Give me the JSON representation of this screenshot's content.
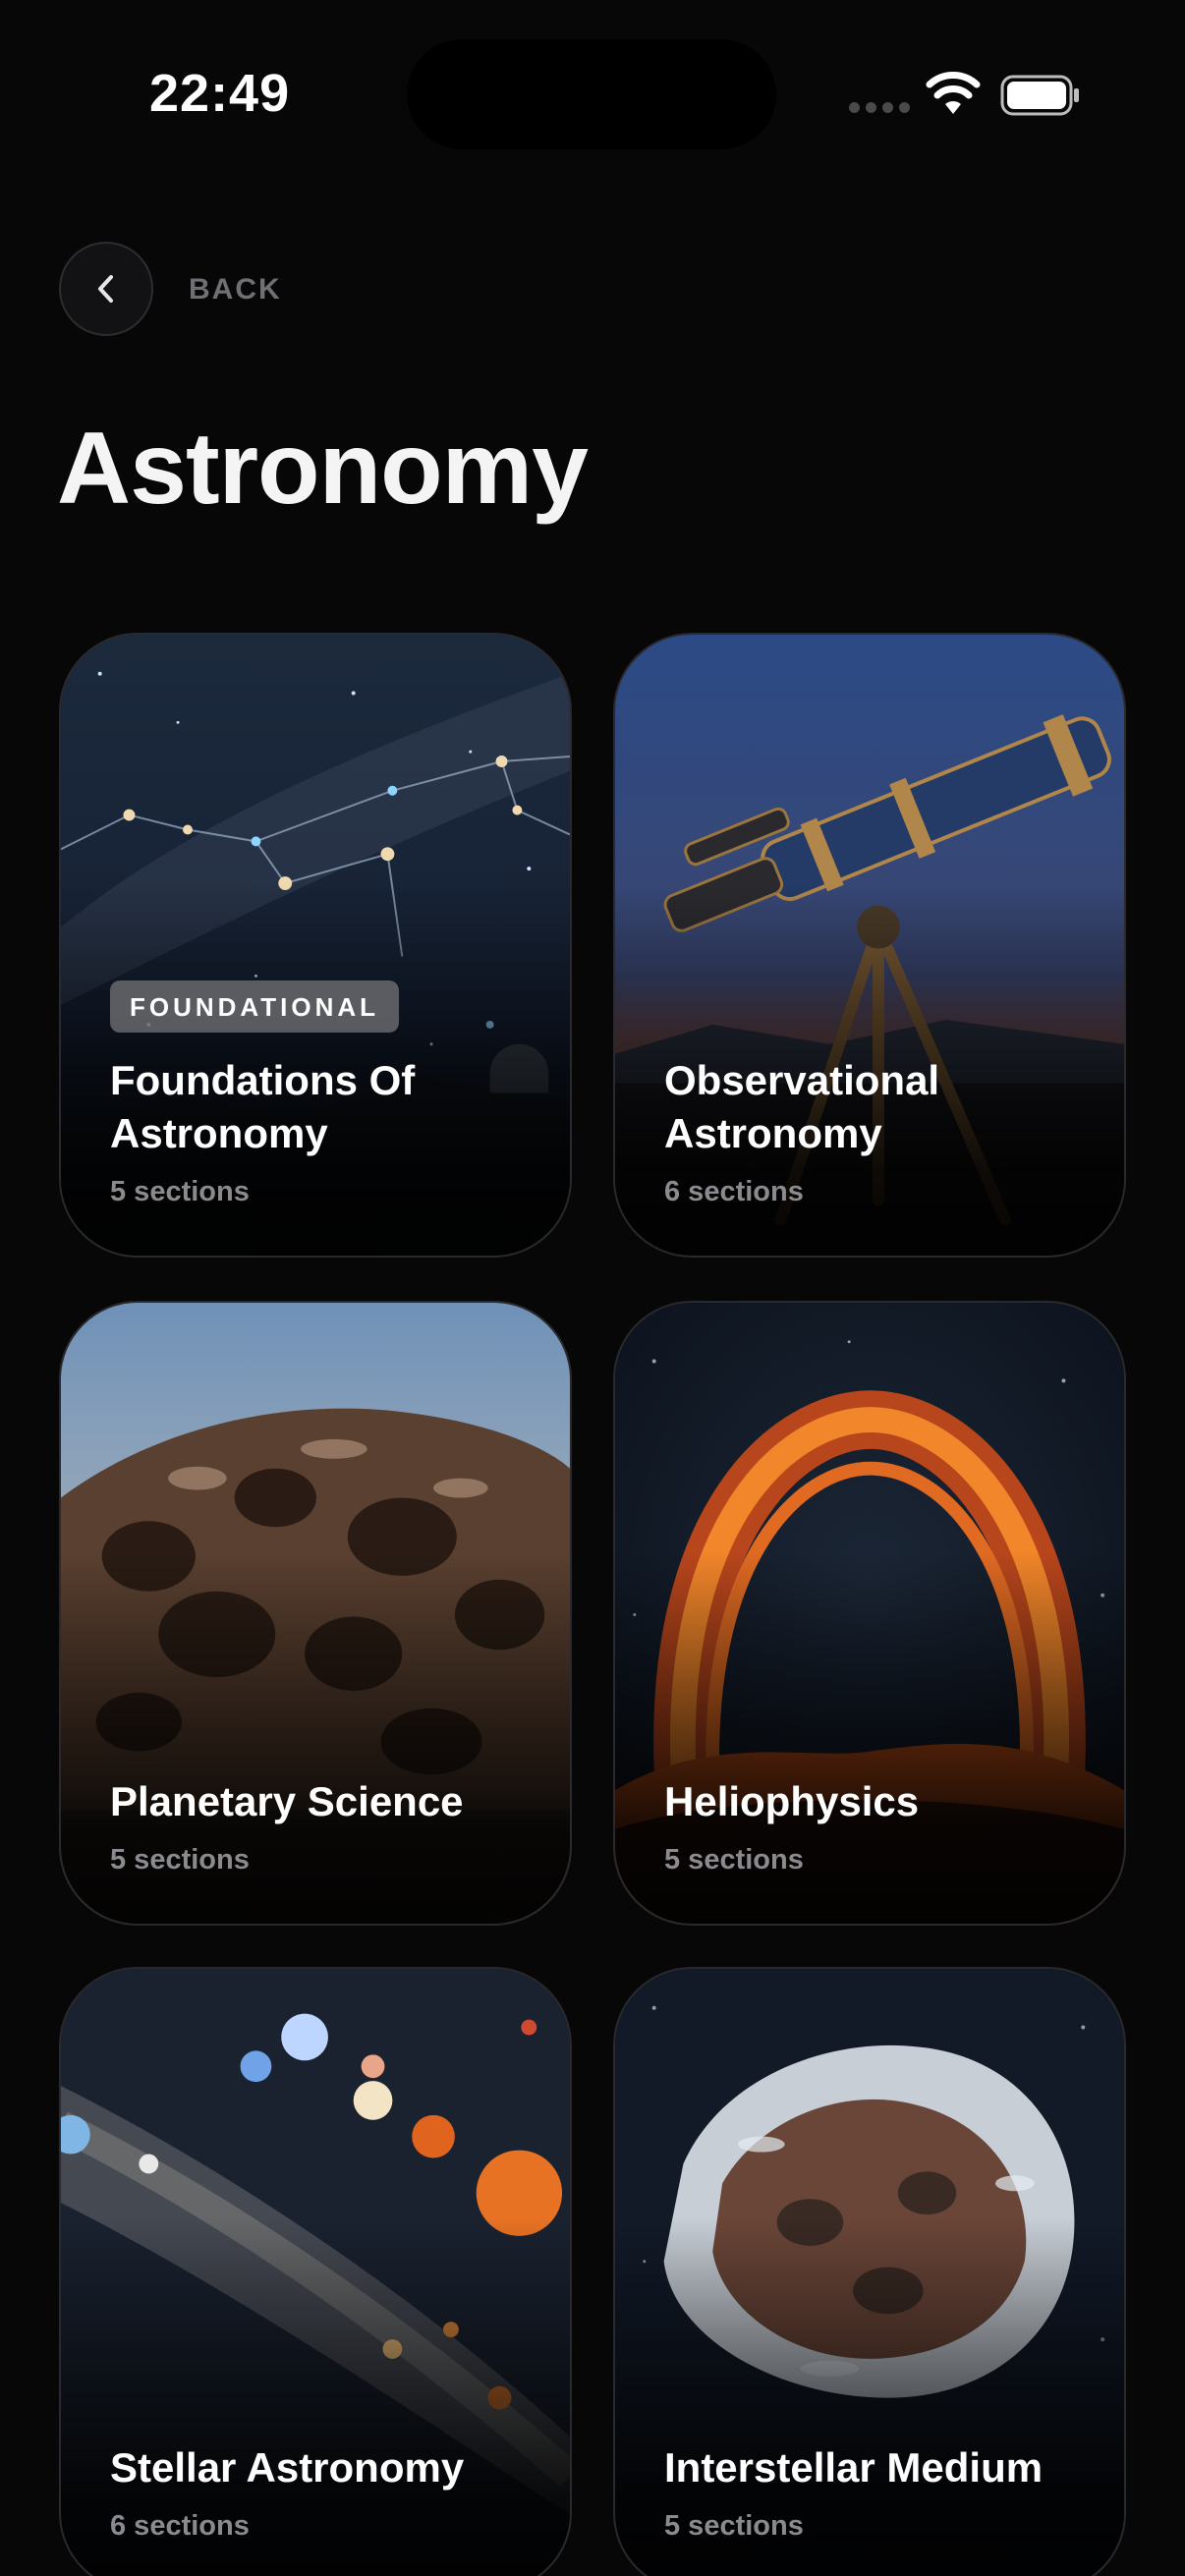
{
  "status_bar": {
    "time": "22:49"
  },
  "nav": {
    "back_label": "BACK"
  },
  "page": {
    "title": "Astronomy"
  },
  "cards": [
    {
      "badge": "FOUNDATIONAL",
      "title": "Foundations Of Astronomy",
      "sections": "5 sections"
    },
    {
      "title": "Observational Astronomy",
      "sections": "6 sections"
    },
    {
      "title": "Planetary Science",
      "sections": "5 sections"
    },
    {
      "title": "Heliophysics",
      "sections": "5 sections"
    },
    {
      "title": "Stellar Astronomy",
      "sections": "6 sections"
    },
    {
      "title": "Interstellar Medium",
      "sections": "5 sections"
    }
  ],
  "colors": {
    "background": "#070708",
    "muted_text": "#8a8a8f",
    "badge": "#78787c"
  }
}
